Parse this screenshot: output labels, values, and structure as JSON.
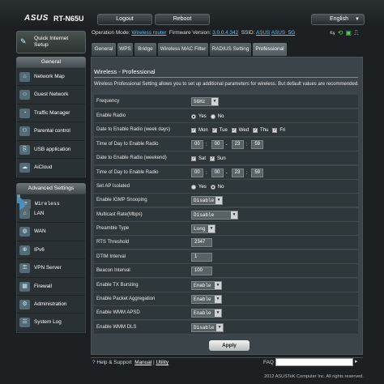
{
  "header": {
    "brand": "ASUS",
    "model": "RT-N65U",
    "logout_label": "Logout",
    "reboot_label": "Reboot",
    "language": "English"
  },
  "status": {
    "operation_mode_label": "Operation Mode:",
    "operation_mode": "Wireless router",
    "firmware_label": "Firmware Version:",
    "firmware": "3.0.0.4.342",
    "ssid_label": "SSID:",
    "ssid_1": "ASUS",
    "ssid_2": "ASUS_5G"
  },
  "tabs": [
    "General",
    "WPS",
    "Bridge",
    "Wireless MAC Filter",
    "RADIUS Setting",
    "Professional"
  ],
  "sidebar": {
    "qis_label_1": "Quick Internet",
    "qis_label_2": "Setup",
    "general_header": "General",
    "general_items": [
      "Network Map",
      "Guest Network",
      "Traffic Manager",
      "Parental control",
      "USB application",
      "AiCloud"
    ],
    "advanced_header": "Advanced Settings",
    "advanced_items": [
      "Wireless",
      "LAN",
      "WAN",
      "IPv6",
      "VPN Server",
      "Firewall",
      "Administration",
      "System Log"
    ]
  },
  "panel": {
    "title": "Wireless - Professional",
    "description": "Wireless Professional Setting allows you to set up additional parameters for wireless. But default values are recommended.",
    "rows": {
      "frequency": {
        "label": "Frequency",
        "value": "5GHz"
      },
      "enable_radio": {
        "label": "Enable Radio",
        "yes": "Yes",
        "no": "No"
      },
      "date_week": {
        "label": "Date to Enable Radio (week days)",
        "mon": "Mon",
        "tue": "Tue",
        "wed": "Wed",
        "thu": "Thu",
        "fri": "Fri"
      },
      "time_week": {
        "label": "Time of Day to Enable Radio",
        "h1": "00",
        "m1": "00",
        "h2": "23",
        "m2": "59",
        "sep": ":",
        "dash": "-"
      },
      "date_weekend": {
        "label": "Date to Enable Radio (weekend)",
        "sat": "Sat",
        "sun": "Sun"
      },
      "time_weekend": {
        "label": "Time of Day to Enable Radio",
        "h1": "00",
        "m1": "00",
        "h2": "23",
        "m2": "59",
        "sep": ":",
        "dash": "-"
      },
      "ap_isolated": {
        "label": "Set AP Isolated",
        "yes": "Yes",
        "no": "No"
      },
      "igmp": {
        "label": "Enable IGMP Snooping",
        "value": "Disable"
      },
      "multicast": {
        "label": "Multicast Rate(Mbps)",
        "value": "Disable"
      },
      "preamble": {
        "label": "Preamble Type",
        "value": "Long"
      },
      "rts": {
        "label": "RTS Threshold",
        "value": "2347"
      },
      "dtim": {
        "label": "DTIM Interval",
        "value": "1"
      },
      "beacon": {
        "label": "Beacon Interval",
        "value": "100"
      },
      "tx_bursting": {
        "label": "Enable TX Bursting",
        "value": "Enable"
      },
      "packet_agg": {
        "label": "Enable Packet Aggregation",
        "value": "Enable"
      },
      "wmm_apsd": {
        "label": "Enable WMM APSD",
        "value": "Enable"
      },
      "wmm_dls": {
        "label": "Enable WMM DLS",
        "value": "Disable"
      }
    },
    "apply_label": "Apply"
  },
  "footer": {
    "help_label": "Help & Support",
    "manual": "Manual",
    "sep": "|",
    "utility": "Utility",
    "faq": "FAQ",
    "copyright": "2012 ASUSTeK Computer Inc. All rights reserved."
  }
}
